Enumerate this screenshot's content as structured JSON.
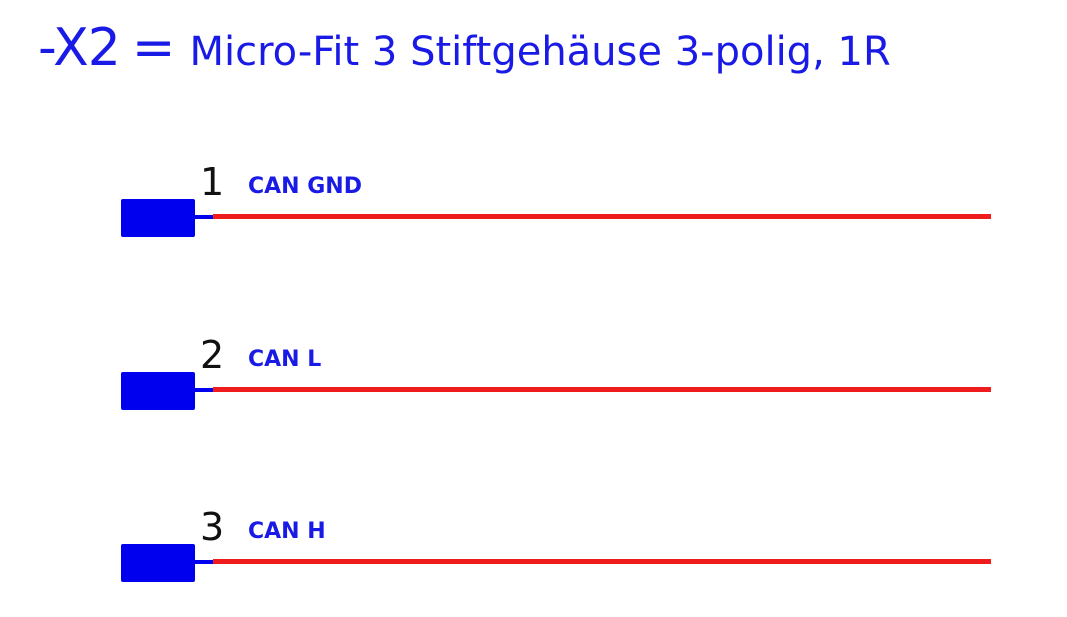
{
  "connector": {
    "designator": "-X2",
    "equals": "=",
    "description": "Micro-Fit 3 Stiftgehäuse 3-polig, 1R"
  },
  "pins": [
    {
      "number": "1",
      "signal": "CAN GND"
    },
    {
      "number": "2",
      "signal": "CAN L"
    },
    {
      "number": "3",
      "signal": "CAN H"
    }
  ],
  "colors": {
    "label_blue": "#1a1ae6",
    "pin_blue": "#0000ee",
    "wire_red": "#ee1c1c",
    "pin_number": "#111111"
  }
}
